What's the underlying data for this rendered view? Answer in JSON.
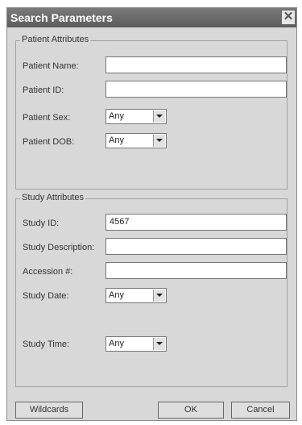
{
  "window": {
    "title": "Search Parameters"
  },
  "patient": {
    "group_title": "Patient Attributes",
    "name_label": "Patient Name:",
    "name_value": "",
    "id_label": "Patient ID:",
    "id_value": "",
    "sex_label": "Patient Sex:",
    "sex_value": "Any",
    "dob_label": "Patient DOB:",
    "dob_value": "Any"
  },
  "study": {
    "group_title": "Study Attributes",
    "id_label": "Study ID:",
    "id_value": "4567",
    "description_label": "Study Description:",
    "description_value": "",
    "accession_label": "Accession #:",
    "accession_value": "",
    "date_label": "Study Date:",
    "date_value": "Any",
    "time_label": "Study Time:",
    "time_value": "Any"
  },
  "buttons": {
    "wildcards": "Wildcards",
    "ok": "OK",
    "cancel": "Cancel"
  },
  "icons": {
    "close": "close-icon",
    "dropdown": "chevron-down-icon"
  }
}
